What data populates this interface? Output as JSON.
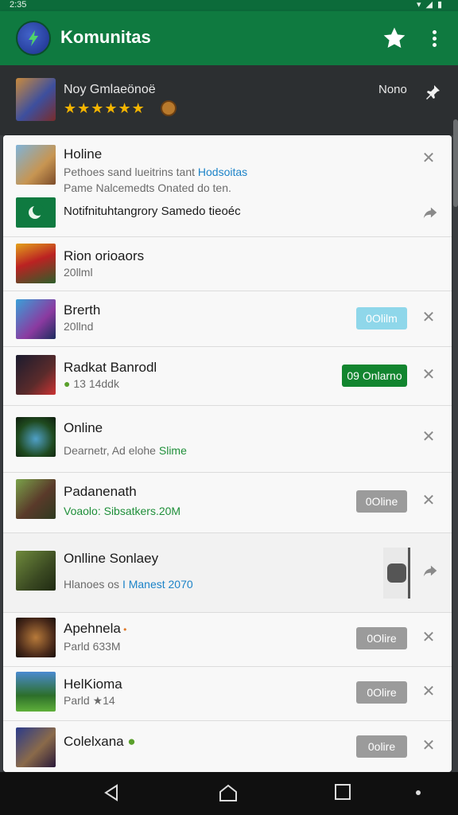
{
  "status_bar": {
    "time": "2:35"
  },
  "app_bar": {
    "title": "Komunitas"
  },
  "featured": {
    "title": "Noy Gmlaeönoë",
    "stars": "★★★★★★",
    "right_label": "Nono"
  },
  "items": [
    {
      "title": "Holine",
      "line1": "Pethoes sand lueitrins tant ",
      "line1_accent": "Hodsoitas",
      "line2": "Pame Nalcemedts Onated do ten.",
      "line3": "Notifnituhtangrory Samedo tieoéc"
    },
    {
      "title": "Rion orioaors",
      "sub": "20llml"
    },
    {
      "title": "Brerth",
      "sub": "20llnd",
      "pill": "0Olilm"
    },
    {
      "title": "Radkat Banrodl",
      "sub": "13 14ddk",
      "pill": "09 Onlarno"
    },
    {
      "title": "Online",
      "sub_prefix": "Dearnetr, Ad elohe ",
      "sub_accent": "Slime"
    },
    {
      "title": "Padanenath",
      "sub": "Voaolo: Sibsatkers.20M",
      "pill": "0Oline"
    },
    {
      "title": "Onlline Sonlaey",
      "sub_prefix": "Hlanoes os ",
      "sub_accent": "I Manest 2070"
    },
    {
      "title": "Apehnela",
      "sub": "Parld 633M",
      "pill": "0Olire"
    },
    {
      "title": "HelKioma",
      "sub": "Parld ★14",
      "pill": "0Olire"
    },
    {
      "title": "Colelxana",
      "pill": "0olire"
    }
  ],
  "colors": {
    "primary": "#0f7a40",
    "status": "#0c6b3a",
    "star": "#f4b400",
    "online_green": "#12852f",
    "link_blue": "#1c83c8"
  }
}
